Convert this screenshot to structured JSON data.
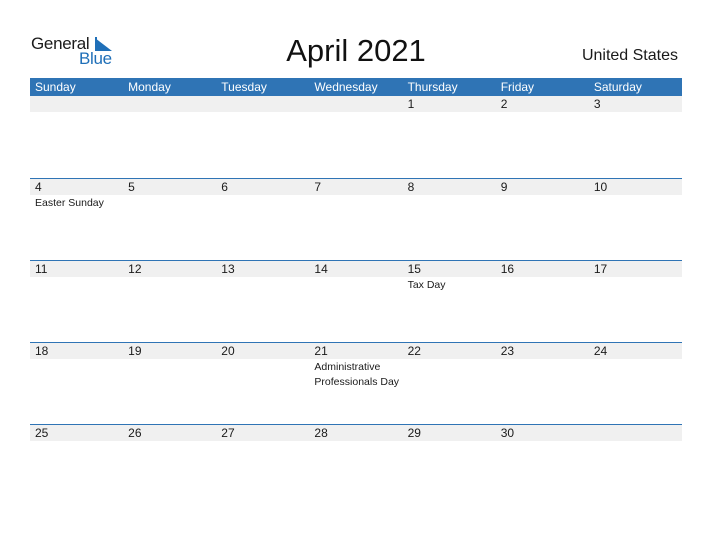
{
  "logo": {
    "general": "General",
    "blue": "Blue"
  },
  "title": "April 2021",
  "country": "United States",
  "colors": {
    "header": "#2f74b5",
    "daynum_bg": "#f0f0f0",
    "logo_blue": "#1f6fb8"
  },
  "weekdays": [
    "Sunday",
    "Monday",
    "Tuesday",
    "Wednesday",
    "Thursday",
    "Friday",
    "Saturday"
  ],
  "weeks": [
    {
      "days": [
        "",
        "",
        "",
        "",
        "1",
        "2",
        "3"
      ],
      "events": [
        "",
        "",
        "",
        "",
        "",
        "",
        ""
      ]
    },
    {
      "days": [
        "4",
        "5",
        "6",
        "7",
        "8",
        "9",
        "10"
      ],
      "events": [
        "Easter Sunday",
        "",
        "",
        "",
        "",
        "",
        ""
      ]
    },
    {
      "days": [
        "11",
        "12",
        "13",
        "14",
        "15",
        "16",
        "17"
      ],
      "events": [
        "",
        "",
        "",
        "",
        "Tax Day",
        "",
        ""
      ]
    },
    {
      "days": [
        "18",
        "19",
        "20",
        "21",
        "22",
        "23",
        "24"
      ],
      "events": [
        "",
        "",
        "",
        "Administrative Professionals Day",
        "",
        "",
        ""
      ]
    },
    {
      "days": [
        "25",
        "26",
        "27",
        "28",
        "29",
        "30",
        ""
      ],
      "events": [
        "",
        "",
        "",
        "",
        "",
        "",
        ""
      ]
    }
  ]
}
